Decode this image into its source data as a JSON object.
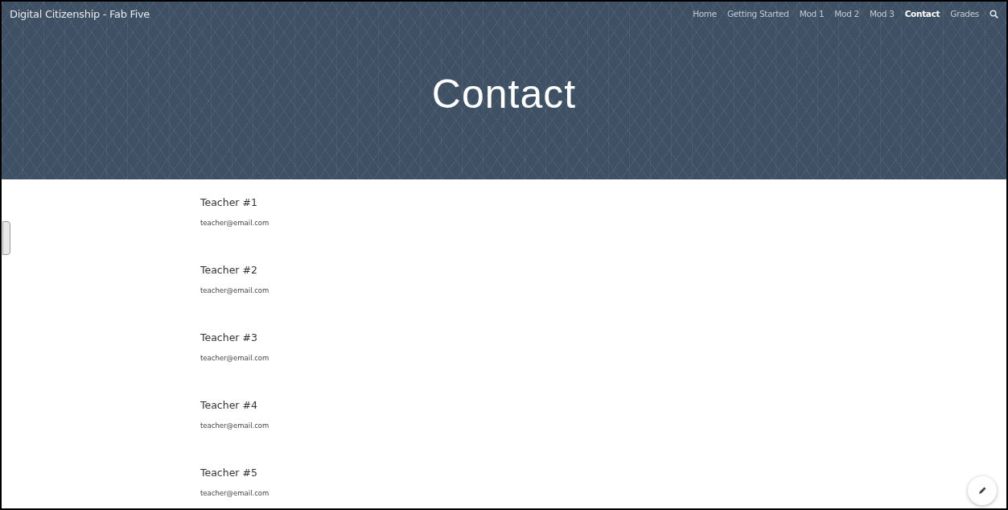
{
  "site_title": "Digital Citizenship - Fab Five",
  "nav": [
    {
      "label": "Home",
      "selected": false
    },
    {
      "label": "Getting Started",
      "selected": false
    },
    {
      "label": "Mod 1",
      "selected": false
    },
    {
      "label": "Mod 2",
      "selected": false
    },
    {
      "label": "Mod 3",
      "selected": false
    },
    {
      "label": "Contact",
      "selected": true
    },
    {
      "label": "Grades",
      "selected": false
    }
  ],
  "page_title": "Contact",
  "contacts": [
    {
      "name": "Teacher #1",
      "email": "teacher@email.com"
    },
    {
      "name": "Teacher #2",
      "email": "teacher@email.com"
    },
    {
      "name": "Teacher #3",
      "email": "teacher@email.com"
    },
    {
      "name": "Teacher #4",
      "email": "teacher@email.com"
    },
    {
      "name": "Teacher #5",
      "email": "teacher@email.com"
    }
  ]
}
